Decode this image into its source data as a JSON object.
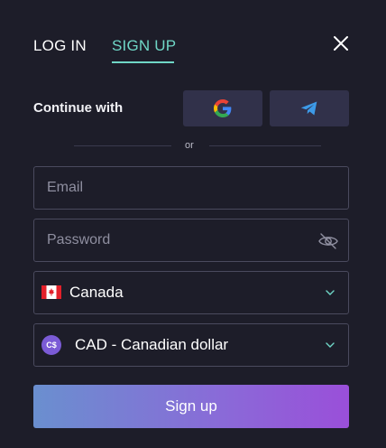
{
  "tabs": {
    "login": "LOG IN",
    "signup": "SIGN UP",
    "active": "signup"
  },
  "social": {
    "label": "Continue with",
    "providers": [
      "google-icon",
      "telegram-icon"
    ]
  },
  "divider": {
    "text": "or"
  },
  "email": {
    "placeholder": "Email",
    "value": ""
  },
  "password": {
    "placeholder": "Password",
    "value": ""
  },
  "country": {
    "selected": "Canada",
    "flag": "canada-flag-icon"
  },
  "currency": {
    "selected": "CAD - Canadian dollar",
    "symbol": "C$"
  },
  "submit": {
    "label": "Sign up"
  },
  "colors": {
    "accent": "#6fd6c6",
    "background": "#1d1d29",
    "button_start": "#6a8fcf",
    "button_end": "#9a4fd9"
  }
}
